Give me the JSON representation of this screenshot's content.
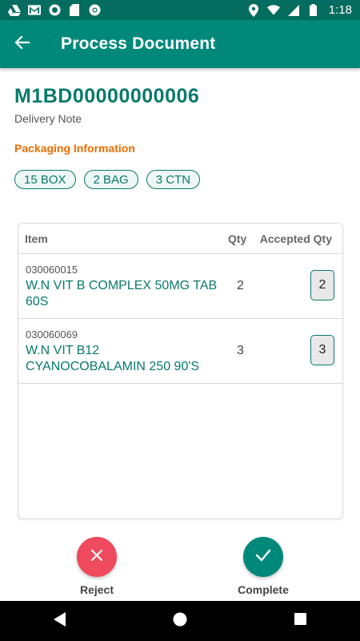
{
  "status_bar": {
    "time": "1:18",
    "left_icons": [
      "drive-icon",
      "gmail-icon",
      "record-icon",
      "sd-card-icon",
      "chrome-icon"
    ],
    "right_icons": [
      "location-icon",
      "wifi-icon",
      "signal-icon",
      "battery-icon"
    ]
  },
  "app_bar": {
    "title": "Process Document",
    "back_icon": "arrow-left-icon",
    "background": "#00897b"
  },
  "document": {
    "number": "M1BD00000000006",
    "type": "Delivery Note"
  },
  "packaging": {
    "heading": "Packaging Information",
    "chips": [
      "15 BOX",
      "2 BAG",
      "3 CTN"
    ]
  },
  "items_table": {
    "headers": {
      "item": "Item",
      "qty": "Qty",
      "accepted_qty": "Accepted Qty"
    },
    "rows": [
      {
        "code": "030060015",
        "name": "W.N VIT B COMPLEX 50MG TAB 60S",
        "qty": "2",
        "accepted_qty": "2"
      },
      {
        "code": "030060069",
        "name": "W.N VIT B12 CYANOCOBALAMIN 250 90'S",
        "qty": "3",
        "accepted_qty": "3"
      }
    ]
  },
  "actions": {
    "reject_label": "Reject",
    "complete_label": "Complete",
    "reject_color": "#ef4a5e",
    "complete_color": "#00897b"
  },
  "colors": {
    "accent": "#087a6c",
    "heading_orange": "#ef6c00"
  }
}
